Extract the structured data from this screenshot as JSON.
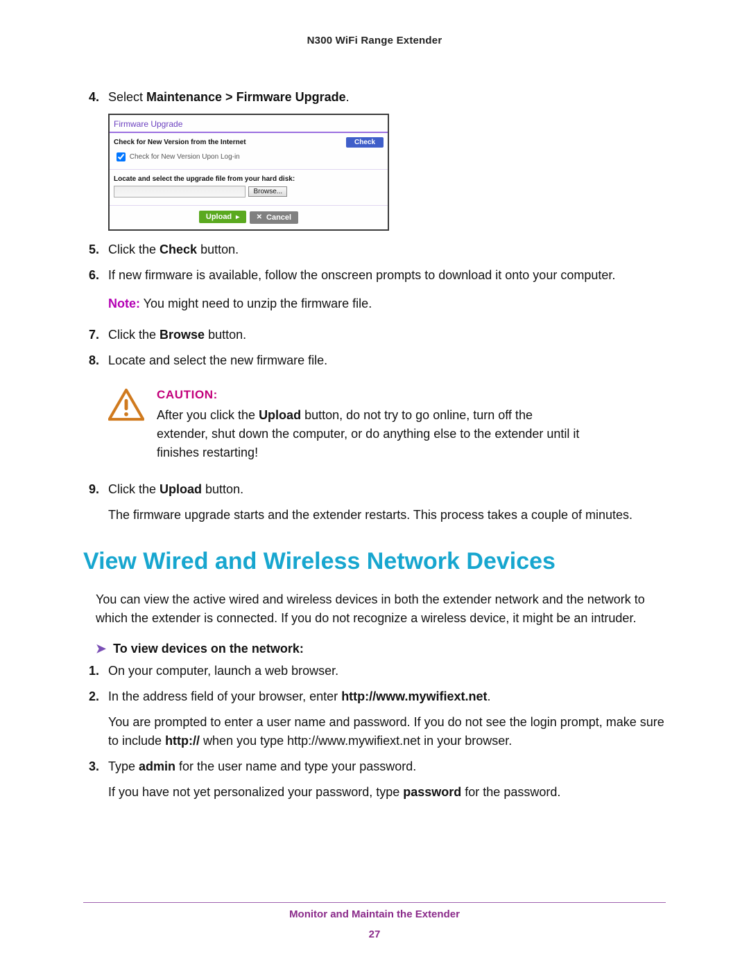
{
  "doc_header": "N300 WiFi Range Extender",
  "steps_a": {
    "s4_num": "4.",
    "s4_pre": "Select ",
    "s4_bold": "Maintenance > Firmware Upgrade",
    "s4_post": ".",
    "s5_num": "5.",
    "s5_pre": "Click the ",
    "s5_bold": "Check",
    "s5_post": " button.",
    "s6_num": "6.",
    "s6_text": "If new firmware is available, follow the onscreen prompts to download it onto your computer.",
    "s7_num": "7.",
    "s7_pre": "Click the ",
    "s7_bold": "Browse",
    "s7_post": " button.",
    "s8_num": "8.",
    "s8_text": "Locate and select the new firmware file.",
    "s9_num": "9.",
    "s9_pre": "Click the ",
    "s9_bold": "Upload",
    "s9_post": " button.",
    "s9_sub": "The firmware upgrade starts and the extender restarts. This process takes a couple of minutes."
  },
  "note": {
    "label": "Note:",
    "text": "  You might need to unzip the firmware file."
  },
  "fw_panel": {
    "title": "Firmware Upgrade",
    "check_new_label": "Check for New Version from the Internet",
    "check_btn": "Check",
    "login_check_label": " Check for New Version Upon Log-in",
    "locate_label": "Locate and select the upgrade file from your hard disk:",
    "browse_label": "Browse...",
    "upload_label": "Upload",
    "cancel_label": "Cancel"
  },
  "caution": {
    "title": "CAUTION:",
    "body_pre": "After you click the ",
    "body_bold": "Upload",
    "body_post": " button, do not try to go online, turn off the extender, shut down the computer, or do anything else to the extender until it finishes restarting!"
  },
  "h1": "View Wired and Wireless Network Devices",
  "para1": "You can view the active wired and wireless devices in both the extender network and the network to which the extender is connected. If you do not recognize a wireless device, it might be an intruder.",
  "proc_hdr_arrow": "➤",
  "proc_hdr": "To view devices on the network:",
  "steps_b": {
    "s1_num": "1.",
    "s1_text": "On your computer, launch a web browser.",
    "s2_num": "2.",
    "s2_pre": "In the address field of your browser, enter ",
    "s2_bold": "http://www.mywifiext.net",
    "s2_post": ".",
    "s2_sub_pre": "You are prompted to enter a user name and password. If you do not see the login prompt, make sure to include ",
    "s2_sub_bold": "http://",
    "s2_sub_post": " when you type http://www.mywifiext.net in your browser.",
    "s3_num": "3.",
    "s3_pre": "Type ",
    "s3_bold1": "admin",
    "s3_mid": " for the user name and type your password.",
    "s3_sub_pre": "If you have not yet personalized your password, type ",
    "s3_sub_bold": "password",
    "s3_sub_post": " for the password."
  },
  "footer": {
    "title": "Monitor and Maintain the Extender",
    "page": "27"
  }
}
